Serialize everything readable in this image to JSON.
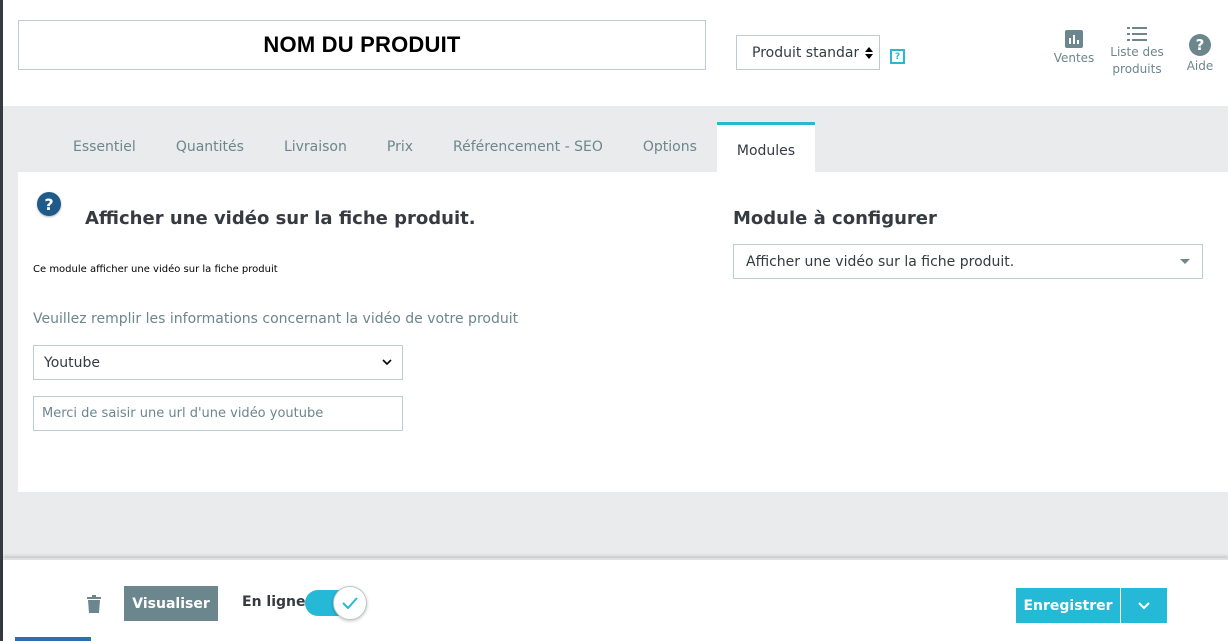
{
  "header": {
    "product_name": "NOM DU PRODUIT",
    "product_type": "Produit standard",
    "help_badge": "?",
    "tools": [
      {
        "label": "Ventes",
        "icon": "bar-chart-icon"
      },
      {
        "label": "Liste des produits",
        "icon": "list-icon"
      },
      {
        "label": "Aide",
        "icon": "help-icon"
      }
    ]
  },
  "tabs": [
    {
      "label": "Essentiel"
    },
    {
      "label": "Quantités"
    },
    {
      "label": "Livraison"
    },
    {
      "label": "Prix"
    },
    {
      "label": "Référencement - SEO"
    },
    {
      "label": "Options"
    },
    {
      "label": "Modules",
      "active": true
    }
  ],
  "module": {
    "help_glyph": "?",
    "title": "Afficher une vidéo sur la fiche produit.",
    "description": "Ce module afficher une vidéo sur la fiche produit",
    "instructions": "Veuillez remplir les informations concernant la vidéo de votre produit",
    "video_source": "Youtube",
    "url_placeholder": "Merci de saisir une url d'une vidéo youtube"
  },
  "configure": {
    "title": "Module à configurer",
    "selected": "Afficher une vidéo sur la fiche produit."
  },
  "footer": {
    "preview_label": "Visualiser",
    "online_label": "En ligne",
    "online_state": true,
    "save_label": "Enregistrer"
  },
  "colors": {
    "accent": "#25b9d7",
    "grey_bg": "#eaebec",
    "button_grey": "#6c868e",
    "text": "#363a41"
  }
}
